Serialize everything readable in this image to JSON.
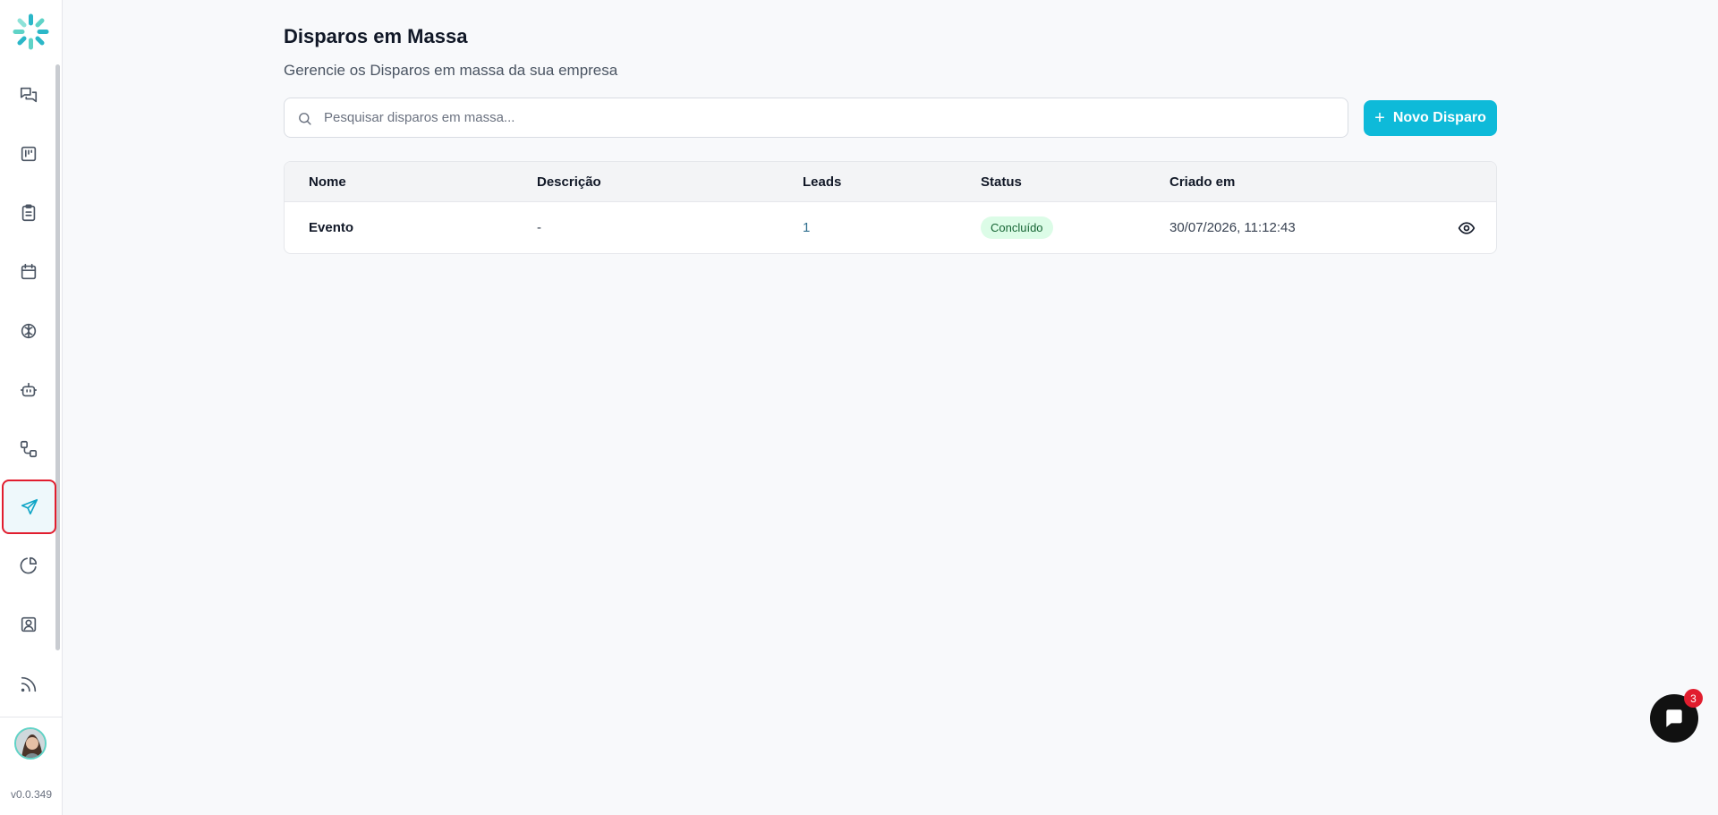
{
  "sidebar": {
    "logo_icon": "app-logo-icon",
    "items": [
      {
        "name": "chats-icon",
        "active": false
      },
      {
        "name": "kanban-icon",
        "active": false
      },
      {
        "name": "clipboard-icon",
        "active": false
      },
      {
        "name": "calendar-icon",
        "active": false
      },
      {
        "name": "brain-icon",
        "active": false
      },
      {
        "name": "bot-icon",
        "active": false
      },
      {
        "name": "workflow-icon",
        "active": false
      },
      {
        "name": "send-icon",
        "active": true
      },
      {
        "name": "pie-chart-icon",
        "active": false
      },
      {
        "name": "contact-icon",
        "active": false
      },
      {
        "name": "rss-icon",
        "active": false
      }
    ],
    "version": "v0.0.349",
    "accent_color": "#0ebad9",
    "highlight_color": "#e11d2e"
  },
  "page": {
    "title": "Disparos em Massa",
    "subtitle": "Gerencie os Disparos em massa da sua empresa"
  },
  "search": {
    "placeholder": "Pesquisar disparos em massa...",
    "value": ""
  },
  "actions": {
    "new_label": "Novo Disparo"
  },
  "table": {
    "headers": {
      "name": "Nome",
      "description": "Descrição",
      "leads": "Leads",
      "status": "Status",
      "created": "Criado em"
    },
    "rows": [
      {
        "name": "Evento",
        "description": "-",
        "leads": "1",
        "status": "Concluído",
        "created": "30/07/2026, 11:12:43"
      }
    ]
  },
  "chat_widget": {
    "badge_count": "3"
  }
}
